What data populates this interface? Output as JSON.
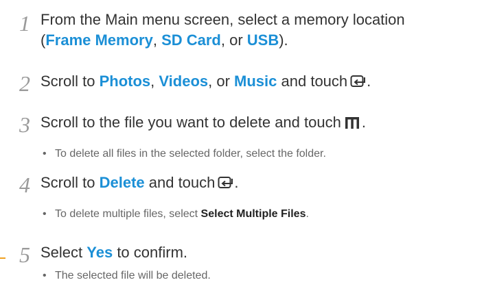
{
  "colors": {
    "highlight": "#1b8fd6",
    "text": "#333333",
    "subtext": "#666666",
    "step_number": "#9a9a9a",
    "marker": "#f0a020"
  },
  "icons": {
    "enter": "enter-icon",
    "menu": "menu-icon"
  },
  "steps": [
    {
      "number": "1",
      "line1_text": "From the Main menu screen, select a memory location",
      "line2_open": "(",
      "loc1": "Frame Memory",
      "sep1": ", ",
      "loc2": "SD Card",
      "sep2": ", or ",
      "loc3": "USB",
      "line2_close": ")."
    },
    {
      "number": "2",
      "text_a": "Scroll to ",
      "item1": "Photos",
      "sep1": ", ",
      "item2": "Videos",
      "sep2": ", or ",
      "item3": "Music",
      "text_b": " and touch",
      "end": "."
    },
    {
      "number": "3",
      "text_a": "Scroll to the file you want to delete and touch",
      "end": ".",
      "note": "To delete all files in the selected folder, select the folder."
    },
    {
      "number": "4",
      "text_a": "Scroll to ",
      "item": "Delete",
      "text_b": " and touch",
      "end": ".",
      "note_a": "To delete multiple files, select ",
      "note_bold": "Select Multiple Files",
      "note_end": "."
    },
    {
      "number": "5",
      "text_a": "Select ",
      "item": "Yes",
      "text_b": " to confirm.",
      "note": "The selected file will be deleted."
    }
  ],
  "bullet": "•"
}
